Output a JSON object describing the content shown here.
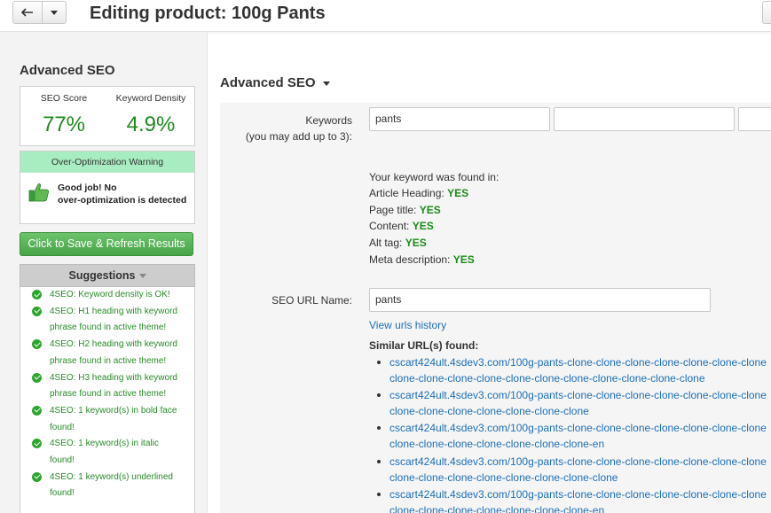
{
  "header": {
    "title": "Editing product: 100g Pants"
  },
  "sidebar": {
    "title": "Advanced SEO",
    "score": {
      "score_label": "SEO Score",
      "score_value": "77%",
      "density_label": "Keyword Density",
      "density_value": "4.9%"
    },
    "warning": {
      "title": "Over-Optimization Warning",
      "line1": "Good job! No",
      "line2": "over-optimization is detected"
    },
    "save_button": "Click to Save & Refresh Results",
    "suggestions": {
      "title": "Suggestions",
      "items": [
        {
          "l1": "4SEO: Keyword density is OK!",
          "l2": ""
        },
        {
          "l1": "4SEO: H1 heading with keyword",
          "l2": "phrase found in active theme!"
        },
        {
          "l1": "4SEO: H2 heading with keyword",
          "l2": "phrase found in active theme!"
        },
        {
          "l1": "4SEO: H3 heading with keyword",
          "l2": "phrase found in active theme!"
        },
        {
          "l1": "4SEO: 1 keyword(s) in bold face",
          "l2": "found!"
        },
        {
          "l1": "4SEO: 1 keyword(s) in italic",
          "l2": "found!"
        },
        {
          "l1": "4SEO: 1 keyword(s) underlined",
          "l2": "found!"
        }
      ]
    }
  },
  "main": {
    "section_title": "Advanced SEO",
    "keywords": {
      "label_line1": "Keywords",
      "label_line2": "(you may add up to 3):",
      "values": [
        "pants",
        "",
        ""
      ]
    },
    "found": {
      "intro": "Your keyword was found in:",
      "rows": [
        {
          "label": "Article Heading:",
          "value": "YES"
        },
        {
          "label": "Page title:",
          "value": "YES"
        },
        {
          "label": "Content:",
          "value": "YES"
        },
        {
          "label": "Alt tag:",
          "value": "YES"
        },
        {
          "label": "Meta description:",
          "value": "YES"
        }
      ]
    },
    "seo_url": {
      "label": "SEO URL Name:",
      "value": "pants",
      "history_link": "View urls history"
    },
    "similar": {
      "title": "Similar URL(s) found:",
      "urls": [
        {
          "l1": "cscart424ult.4sdev3.com/100g-pants-clone-clone-clone-clone-clone-clone-clone",
          "l2": "clone-clone-clone-clone-clone-clone-clone-clone-clone-clone-clone"
        },
        {
          "l1": "cscart424ult.4sdev3.com/100g-pants-clone-clone-clone-clone-clone-clone-clone",
          "l2": "clone-clone-clone-clone-clone-clone-clone"
        },
        {
          "l1": "cscart424ult.4sdev3.com/100g-pants-clone-clone-clone-clone-clone-clone-clone",
          "l2": "clone-clone-clone-clone-clone-clone-clone-en"
        },
        {
          "l1": "cscart424ult.4sdev3.com/100g-pants-clone-clone-clone-clone-clone-clone-clone",
          "l2": "clone-clone-clone-clone-clone-clone-clone-clone"
        },
        {
          "l1": "cscart424ult.4sdev3.com/100g-pants-clone-clone-clone-clone-clone-clone-clone",
          "l2": "clone-clone-clone-clone-clone-clone-clone-en"
        }
      ]
    }
  }
}
